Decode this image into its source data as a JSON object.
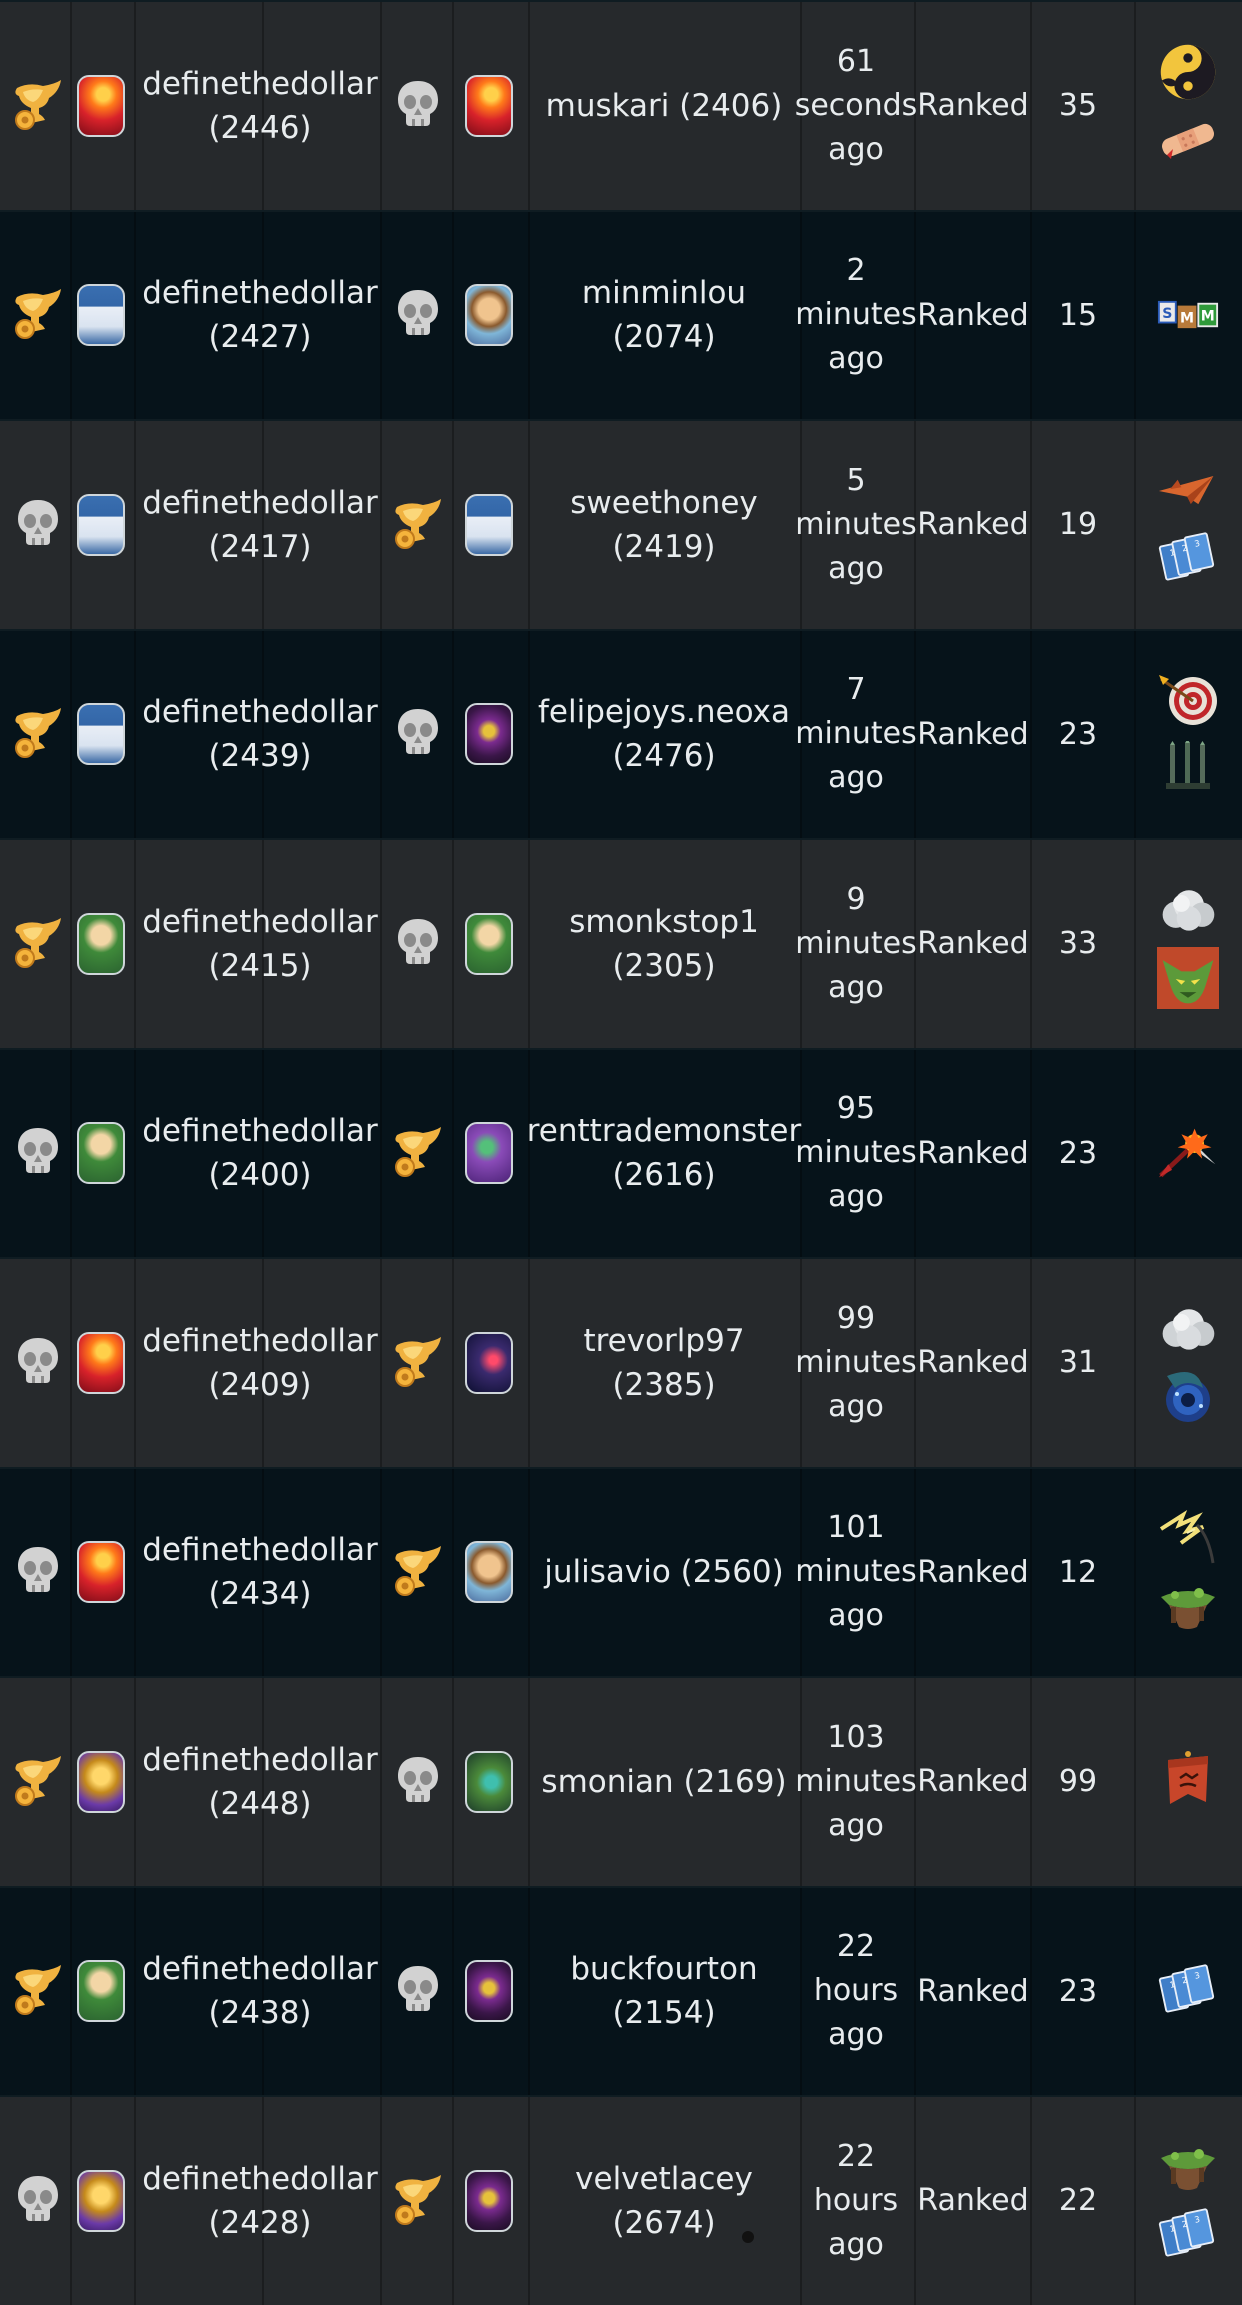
{
  "colors": {
    "row_light": "#26292c",
    "row_dark": "#06131a",
    "trophy": "#e8a23a",
    "skull": "#cfcfcf"
  },
  "matches": [
    {
      "p1_result": "trophy-icon",
      "p1_avatar": "fire",
      "p1_name": "definethedollar\n(2446)",
      "p2_result": "skull-icon",
      "p2_avatar": "fire",
      "p2_name": "muskari (2406)",
      "time": "61\nseconds\nago",
      "format": "Ranked",
      "mana": "35",
      "rulesets": [
        "yin-yang-icon",
        "bandage-icon"
      ]
    },
    {
      "p1_result": "trophy-icon",
      "p1_avatar": "wizard",
      "p1_name": "definethedollar\n(2427)",
      "p2_result": "skull-icon",
      "p2_avatar": "guy",
      "p2_name": "minminlou (2074)",
      "time": "2\nminutes\nago",
      "format": "Ranked",
      "mana": "15",
      "rulesets": [
        "letter-blocks-icon"
      ]
    },
    {
      "p1_result": "skull-icon",
      "p1_avatar": "wizard",
      "p1_name": "definethedollar\n(2417)",
      "p2_result": "trophy-icon",
      "p2_avatar": "wizard",
      "p2_name": "sweethoney\n(2419)",
      "time": "5\nminutes\nago",
      "format": "Ranked",
      "mana": "19",
      "rulesets": [
        "paper-plane-icon",
        "cards-icon"
      ]
    },
    {
      "p1_result": "trophy-icon",
      "p1_avatar": "wizard",
      "p1_name": "definethedollar\n(2439)",
      "p2_result": "skull-icon",
      "p2_avatar": "dark",
      "p2_name": "felipejoys.neoxa\n(2476)",
      "time": "7\nminutes\nago",
      "format": "Ranked",
      "mana": "23",
      "rulesets": [
        "target-icon",
        "swords-icon"
      ]
    },
    {
      "p1_result": "trophy-icon",
      "p1_avatar": "elf",
      "p1_name": "definethedollar\n(2415)",
      "p2_result": "skull-icon",
      "p2_avatar": "elf",
      "p2_name": "smonkstop1\n(2305)",
      "time": "9\nminutes\nago",
      "format": "Ranked",
      "mana": "33",
      "rulesets": [
        "cloud-icon",
        "goblin-icon"
      ]
    },
    {
      "p1_result": "skull-icon",
      "p1_avatar": "elf",
      "p1_name": "definethedollar\n(2400)",
      "p2_result": "trophy-icon",
      "p2_avatar": "purple",
      "p2_name": "renttrademonster\n(2616)",
      "time": "95\nminutes\nago",
      "format": "Ranked",
      "mana": "23",
      "rulesets": [
        "explosive-arrow-icon"
      ]
    },
    {
      "p1_result": "skull-icon",
      "p1_avatar": "fire",
      "p1_name": "definethedollar\n(2409)",
      "p2_result": "trophy-icon",
      "p2_avatar": "space",
      "p2_name": "trevorlp97 (2385)",
      "time": "99\nminutes\nago",
      "format": "Ranked",
      "mana": "31",
      "rulesets": [
        "cloud-icon",
        "vortex-icon"
      ]
    },
    {
      "p1_result": "skull-icon",
      "p1_avatar": "fire",
      "p1_name": "definethedollar\n(2434)",
      "p2_result": "trophy-icon",
      "p2_avatar": "guy",
      "p2_name": "julisavio (2560)",
      "time": "101\nminutes\nago",
      "format": "Ranked",
      "mana": "12",
      "rulesets": [
        "lightning-icon",
        "floating-island-icon"
      ]
    },
    {
      "p1_result": "trophy-icon",
      "p1_avatar": "golden",
      "p1_name": "definethedollar\n(2448)",
      "p2_result": "skull-icon",
      "p2_avatar": "dragon",
      "p2_name": "smonian (2169)",
      "time": "103\nminutes\nago",
      "format": "Ranked",
      "mana": "99",
      "rulesets": [
        "banner-icon"
      ]
    },
    {
      "p1_result": "trophy-icon",
      "p1_avatar": "elf",
      "p1_name": "definethedollar\n(2438)",
      "p2_result": "skull-icon",
      "p2_avatar": "dark",
      "p2_name": "buckfourton\n(2154)",
      "time": "22\nhours\nago",
      "format": "Ranked",
      "mana": "23",
      "rulesets": [
        "cards-icon"
      ]
    },
    {
      "p1_result": "skull-icon",
      "p1_avatar": "golden",
      "p1_name": "definethedollar\n(2428)",
      "p2_result": "trophy-icon",
      "p2_avatar": "dark",
      "p2_name": "velvetlacey (2674)",
      "time": "22\nhours\nago",
      "format": "Ranked",
      "mana": "22",
      "rulesets": [
        "floating-island-icon",
        "cards-icon"
      ]
    }
  ]
}
